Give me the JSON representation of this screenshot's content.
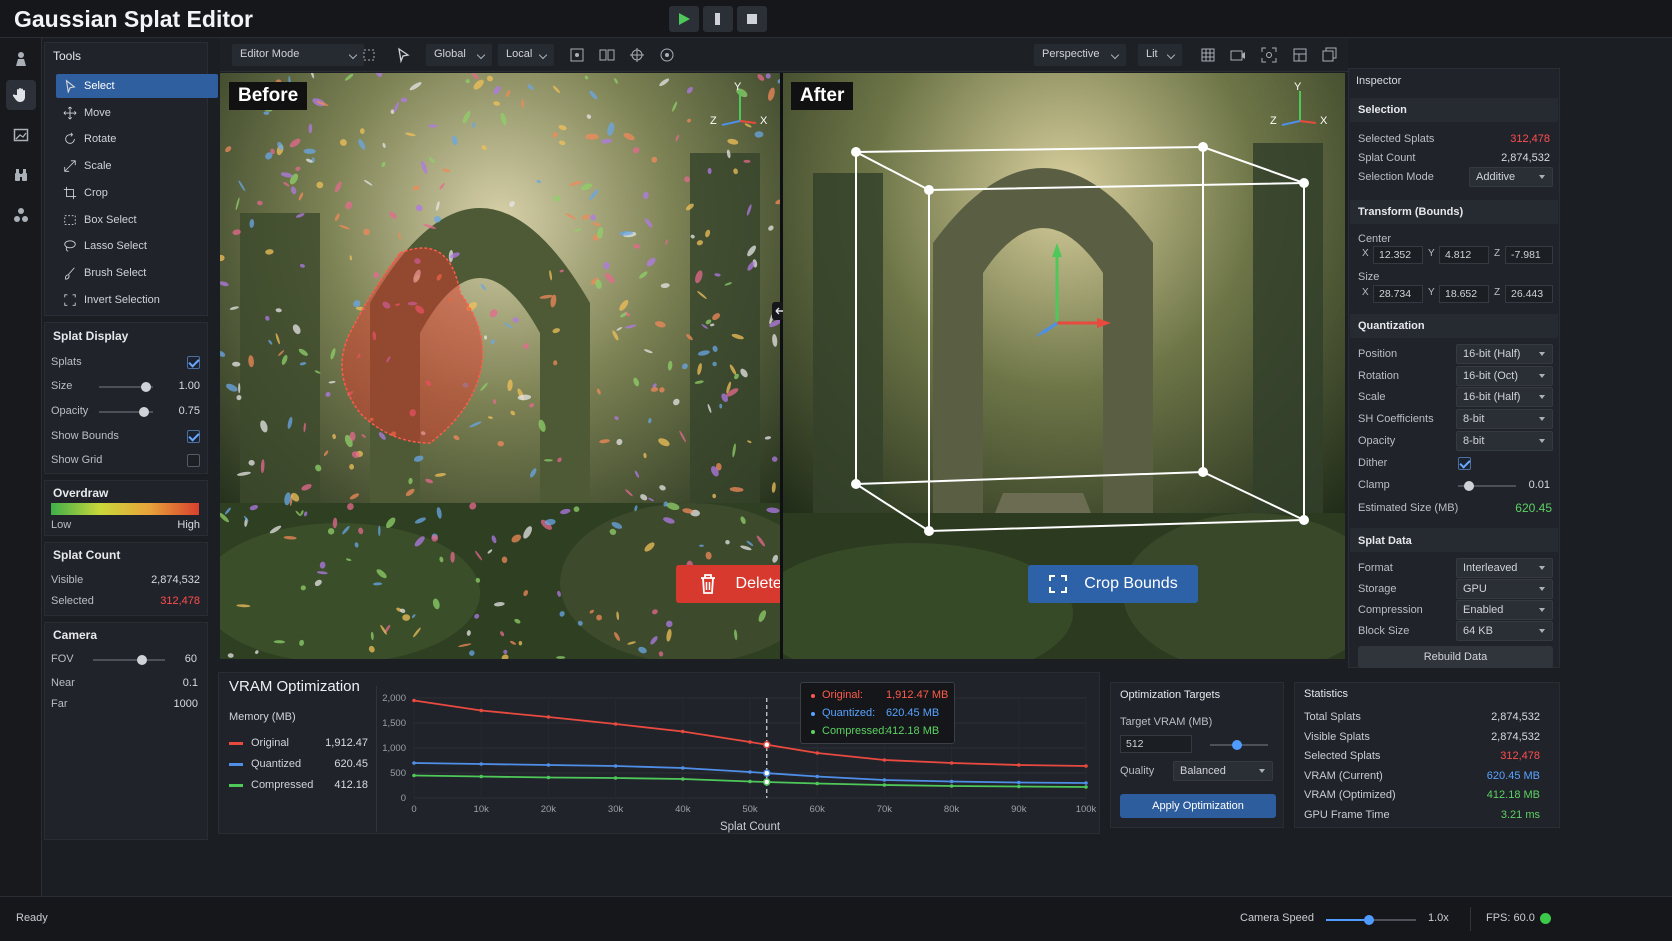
{
  "app": {
    "title": "Gaussian Splat Editor"
  },
  "playback": {
    "play_icon": "play-icon",
    "pause_icon": "pause-icon",
    "stop_icon": "stop-icon"
  },
  "toolbar": {
    "mode": "Editor Mode",
    "space_global": "Global",
    "space_local": "Local",
    "projection": "Perspective",
    "shading": "Lit"
  },
  "tools": {
    "header": "Tools",
    "items": [
      {
        "label": "Select",
        "icon": "cursor-icon"
      },
      {
        "label": "Move",
        "icon": "move-icon"
      },
      {
        "label": "Rotate",
        "icon": "rotate-icon"
      },
      {
        "label": "Scale",
        "icon": "scale-icon"
      },
      {
        "label": "Crop",
        "icon": "crop-icon"
      },
      {
        "label": "Box Select",
        "icon": "box-select-icon"
      },
      {
        "label": "Lasso Select",
        "icon": "lasso-icon"
      },
      {
        "label": "Brush Select",
        "icon": "brush-icon"
      },
      {
        "label": "Invert Selection",
        "icon": "invert-icon"
      }
    ]
  },
  "splat_display": {
    "header": "Splat Display",
    "splats_label": "Splats",
    "size_label": "Size",
    "size_value": "1.00",
    "opacity_label": "Opacity",
    "opacity_value": "0.75",
    "show_bounds_label": "Show Bounds",
    "show_grid_label": "Show Grid"
  },
  "overdraw": {
    "header": "Overdraw",
    "low": "Low",
    "high": "High"
  },
  "splat_count": {
    "header": "Splat Count",
    "visible_label": "Visible",
    "visible_value": "2,874,532",
    "selected_label": "Selected",
    "selected_value": "312,478"
  },
  "camera": {
    "header": "Camera",
    "fov_label": "FOV",
    "fov_value": "60",
    "near_label": "Near",
    "near_value": "0.1",
    "far_label": "Far",
    "far_value": "1000"
  },
  "viewports": {
    "before_label": "Before",
    "after_label": "After",
    "delete_button": "Delete Selected",
    "crop_button": "Crop Bounds",
    "axis_x": "X",
    "axis_y": "Y",
    "axis_z": "Z"
  },
  "inspector": {
    "header": "Inspector",
    "selection_header": "Selection",
    "selected_splats_label": "Selected Splats",
    "selected_splats_value": "312,478",
    "splat_count_label": "Splat Count",
    "splat_count_value": "2,874,532",
    "selection_mode_label": "Selection Mode",
    "selection_mode_value": "Additive",
    "transform_header": "Transform (Bounds)",
    "center_label": "Center",
    "center_x": "12.352",
    "center_y": "4.812",
    "center_z": "-7.981",
    "size_label": "Size",
    "size_x": "28.734",
    "size_y": "18.652",
    "size_z": "26.443",
    "x": "X",
    "y": "Y",
    "z": "Z",
    "quant_header": "Quantization",
    "position_label": "Position",
    "position_value": "16-bit (Half)",
    "rotation_label": "Rotation",
    "rotation_value": "16-bit (Oct)",
    "scale_label": "Scale",
    "scale_value": "16-bit (Half)",
    "sh_label": "SH Coefficients",
    "sh_value": "8-bit",
    "opacity_label": "Opacity",
    "opacity_value": "8-bit",
    "dither_label": "Dither",
    "clamp_label": "Clamp",
    "clamp_value": "0.01",
    "est_label": "Estimated Size (MB)",
    "est_value": "620.45",
    "splat_data_header": "Splat Data",
    "format_label": "Format",
    "format_value": "Interleaved",
    "storage_label": "Storage",
    "storage_value": "GPU",
    "compression_label": "Compression",
    "compression_value": "Enabled",
    "block_label": "Block Size",
    "block_value": "64 KB",
    "rebuild_button": "Rebuild Data"
  },
  "vram": {
    "header": "VRAM Optimization",
    "memory_label": "Memory (MB)",
    "legend": [
      {
        "name": "Original",
        "value": "1,912.47",
        "color": "#e84a3f"
      },
      {
        "name": "Quantized",
        "value": "620.45",
        "color": "#4f8fe8"
      },
      {
        "name": "Compressed",
        "value": "412.18",
        "color": "#4fc85a"
      }
    ],
    "tooltip": [
      {
        "name": "Original:",
        "value": "1,912.47 MB"
      },
      {
        "name": "Quantized:",
        "value": "620.45 MB"
      },
      {
        "name": "Compressed:",
        "value": "412.18 MB"
      }
    ]
  },
  "chart_data": {
    "type": "line",
    "xlabel": "Splat Count",
    "ylabel": "",
    "x": [
      0,
      10000,
      20000,
      30000,
      40000,
      50000,
      60000,
      70000,
      80000,
      90000,
      100000
    ],
    "xticks": [
      "0",
      "10k",
      "20k",
      "30k",
      "40k",
      "50k",
      "60k",
      "70k",
      "80k",
      "90k",
      "100k"
    ],
    "yticks": [
      "0",
      "500",
      "1,000",
      "1,500",
      "2,000"
    ],
    "ylim": [
      0,
      2000
    ],
    "xlim": [
      0,
      100000
    ],
    "grid": true,
    "cursor_x": 52500,
    "series": [
      {
        "name": "Original",
        "color": "#e84a3f",
        "values": [
          1950,
          1750,
          1620,
          1480,
          1330,
          1120,
          900,
          760,
          700,
          660,
          640
        ]
      },
      {
        "name": "Quantized",
        "color": "#4f8fe8",
        "values": [
          700,
          680,
          660,
          640,
          600,
          520,
          430,
          360,
          330,
          310,
          300
        ]
      },
      {
        "name": "Compressed",
        "color": "#4fc85a",
        "values": [
          450,
          430,
          410,
          400,
          380,
          330,
          290,
          260,
          240,
          230,
          220
        ]
      }
    ]
  },
  "targets": {
    "header": "Optimization Targets",
    "target_label": "Target VRAM (MB)",
    "target_value": "512",
    "quality_label": "Quality",
    "quality_value": "Balanced",
    "apply_button": "Apply Optimization"
  },
  "statistics": {
    "header": "Statistics",
    "rows": [
      {
        "label": "Total Splats",
        "value": "2,874,532",
        "color": ""
      },
      {
        "label": "Visible Splats",
        "value": "2,874,532",
        "color": ""
      },
      {
        "label": "Selected Splats",
        "value": "312,478",
        "color": "red"
      },
      {
        "label": "VRAM (Current)",
        "value": "620.45 MB",
        "color": "blue"
      },
      {
        "label": "VRAM (Optimized)",
        "value": "412.18 MB",
        "color": "green"
      },
      {
        "label": "GPU Frame Time",
        "value": "3.21 ms",
        "color": "green"
      }
    ]
  },
  "status": {
    "ready": "Ready",
    "camera_speed_label": "Camera Speed",
    "camera_speed_value": "1.0x",
    "fps": "FPS: 60.0"
  }
}
